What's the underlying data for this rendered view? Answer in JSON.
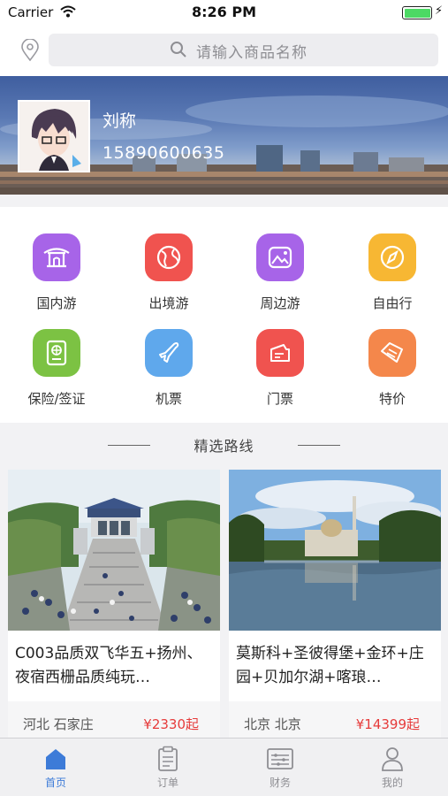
{
  "status_bar": {
    "carrier": "Carrier",
    "time": "8:26 PM"
  },
  "search": {
    "placeholder": "请输入商品名称"
  },
  "profile": {
    "name": "刘称",
    "phone": "15890600635"
  },
  "categories": [
    {
      "label": "国内游",
      "icon": "temple-icon",
      "color": "#a764e8"
    },
    {
      "label": "出境游",
      "icon": "globe-icon",
      "color": "#f0534f"
    },
    {
      "label": "周边游",
      "icon": "landscape-icon",
      "color": "#a764e8"
    },
    {
      "label": "自由行",
      "icon": "compass-icon",
      "color": "#f7b733"
    },
    {
      "label": "保险/签证",
      "icon": "passport-icon",
      "color": "#7cc243"
    },
    {
      "label": "机票",
      "icon": "airplane-icon",
      "color": "#5fa8ec"
    },
    {
      "label": "门票",
      "icon": "ticket-icon",
      "color": "#f0534f"
    },
    {
      "label": "特价",
      "icon": "tag-icon",
      "color": "#f4874b"
    }
  ],
  "section": {
    "title": "精选路线"
  },
  "routes": [
    {
      "title": "C003品质双飞华五+扬州、夜宿西栅品质纯玩…",
      "location": "河北 石家庄",
      "price": "¥2330起"
    },
    {
      "title": "莫斯科+圣彼得堡+金环+庄园+贝加尔湖+喀琅…",
      "location": "北京 北京",
      "price": "¥14399起"
    }
  ],
  "tabs": [
    {
      "label": "首页",
      "active": true
    },
    {
      "label": "订单",
      "active": false
    },
    {
      "label": "财务",
      "active": false
    },
    {
      "label": "我的",
      "active": false
    }
  ],
  "colors": {
    "accent": "#3d7bd8",
    "price": "#e63b3b"
  }
}
